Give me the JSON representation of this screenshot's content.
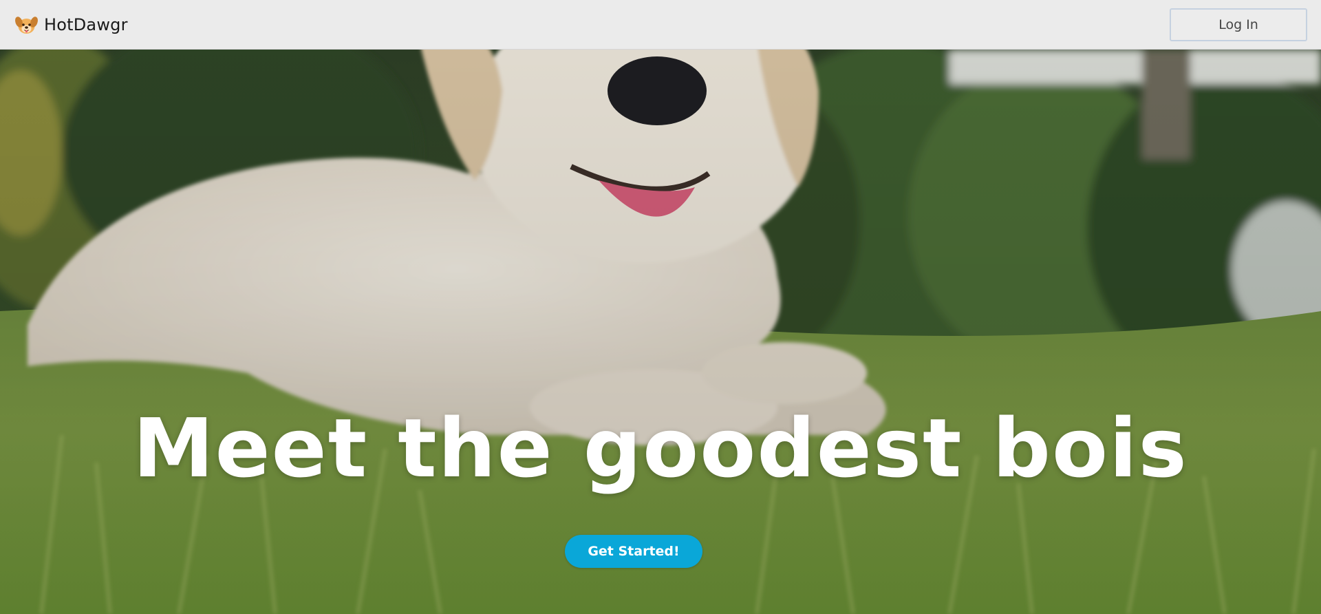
{
  "app": {
    "brand_name": "HotDawgr",
    "brand_icon": "dog-face-icon"
  },
  "header": {
    "login_label": "Log In"
  },
  "hero": {
    "headline": "Meet the goodest bois",
    "cta_label": "Get Started!",
    "background": "photo-golden-retriever-puppy-on-grass"
  },
  "colors": {
    "cta": "#0aa7d8",
    "navbar": "#ebebeb",
    "login_border": "#c5d1e0"
  }
}
